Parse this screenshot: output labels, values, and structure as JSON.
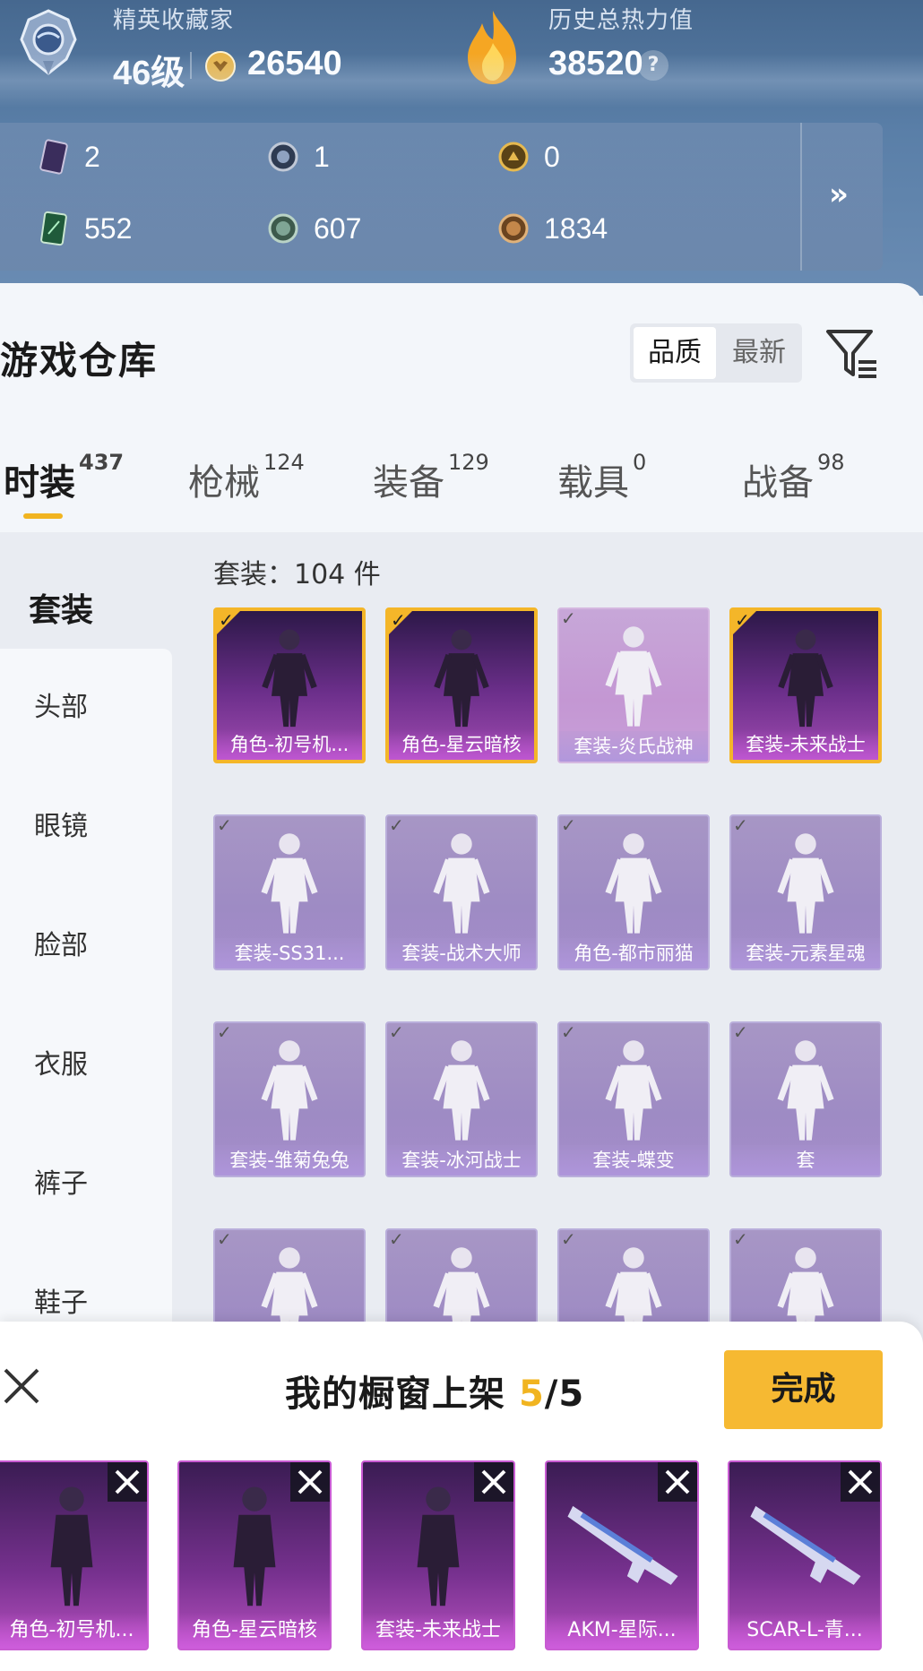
{
  "header": {
    "rank_title": "精英收藏家",
    "level": "46级",
    "coins": "26540",
    "heat_label": "历史总热力值",
    "heat_value": "38520",
    "help_glyph": "?"
  },
  "resources": {
    "row1": [
      {
        "icon": "purple-card-icon",
        "value": "2"
      },
      {
        "icon": "silver-medal-icon",
        "value": "1"
      },
      {
        "icon": "gold-medal-icon",
        "value": "0"
      }
    ],
    "row2": [
      {
        "icon": "green-card-icon",
        "value": "552"
      },
      {
        "icon": "green-coin-icon",
        "value": "607"
      },
      {
        "icon": "bronze-coin-icon",
        "value": "1834"
      }
    ],
    "more_glyph": "»"
  },
  "warehouse": {
    "title": "游戏仓库",
    "sort_quality": "品质",
    "sort_latest": "最新"
  },
  "category_tabs": [
    {
      "label": "时装",
      "count": "437",
      "active": true
    },
    {
      "label": "枪械",
      "count": "124"
    },
    {
      "label": "装备",
      "count": "129"
    },
    {
      "label": "载具",
      "count": "0"
    },
    {
      "label": "战备",
      "count": "98"
    }
  ],
  "side_nav": {
    "active": "套装",
    "items": [
      "头部",
      "眼镜",
      "脸部",
      "衣服",
      "裤子",
      "鞋子"
    ]
  },
  "grid": {
    "count_label": "套装：104 件",
    "items": [
      {
        "label": "角色-初号机...",
        "state": "selected"
      },
      {
        "label": "角色-星云暗核",
        "state": "selected"
      },
      {
        "label": "套装-炎氏战神",
        "state": "dimpink"
      },
      {
        "label": "套装-未来战士",
        "state": "selected"
      },
      {
        "label": "套装-SS31...",
        "state": "dim"
      },
      {
        "label": "套装-战术大师",
        "state": "dim"
      },
      {
        "label": "角色-都市丽猫",
        "state": "dim"
      },
      {
        "label": "套装-元素星魂",
        "state": "dim"
      },
      {
        "label": "套装-雏菊兔兔",
        "state": "dim"
      },
      {
        "label": "套装-冰河战士",
        "state": "dim"
      },
      {
        "label": "套装-蝶变",
        "state": "dim"
      },
      {
        "label": "套",
        "state": "dim"
      },
      {
        "label": "",
        "state": "dim"
      },
      {
        "label": "",
        "state": "dim"
      },
      {
        "label": "",
        "state": "dim"
      },
      {
        "label": "",
        "state": "dim"
      }
    ],
    "check_glyph": "✓"
  },
  "shelf": {
    "title": "我的橱窗上架 ",
    "count_current": "5",
    "count_total": "/5",
    "done_label": "完成",
    "slots": [
      {
        "label": "角色-初号机..."
      },
      {
        "label": "角色-星云暗核"
      },
      {
        "label": "套装-未来战士"
      },
      {
        "label": "AKM-星际..."
      },
      {
        "label": "SCAR-L-青..."
      }
    ]
  },
  "colors": {
    "accent": "#f1b420",
    "button": "#f6b932",
    "tile_purple": "#6c2f8b"
  }
}
